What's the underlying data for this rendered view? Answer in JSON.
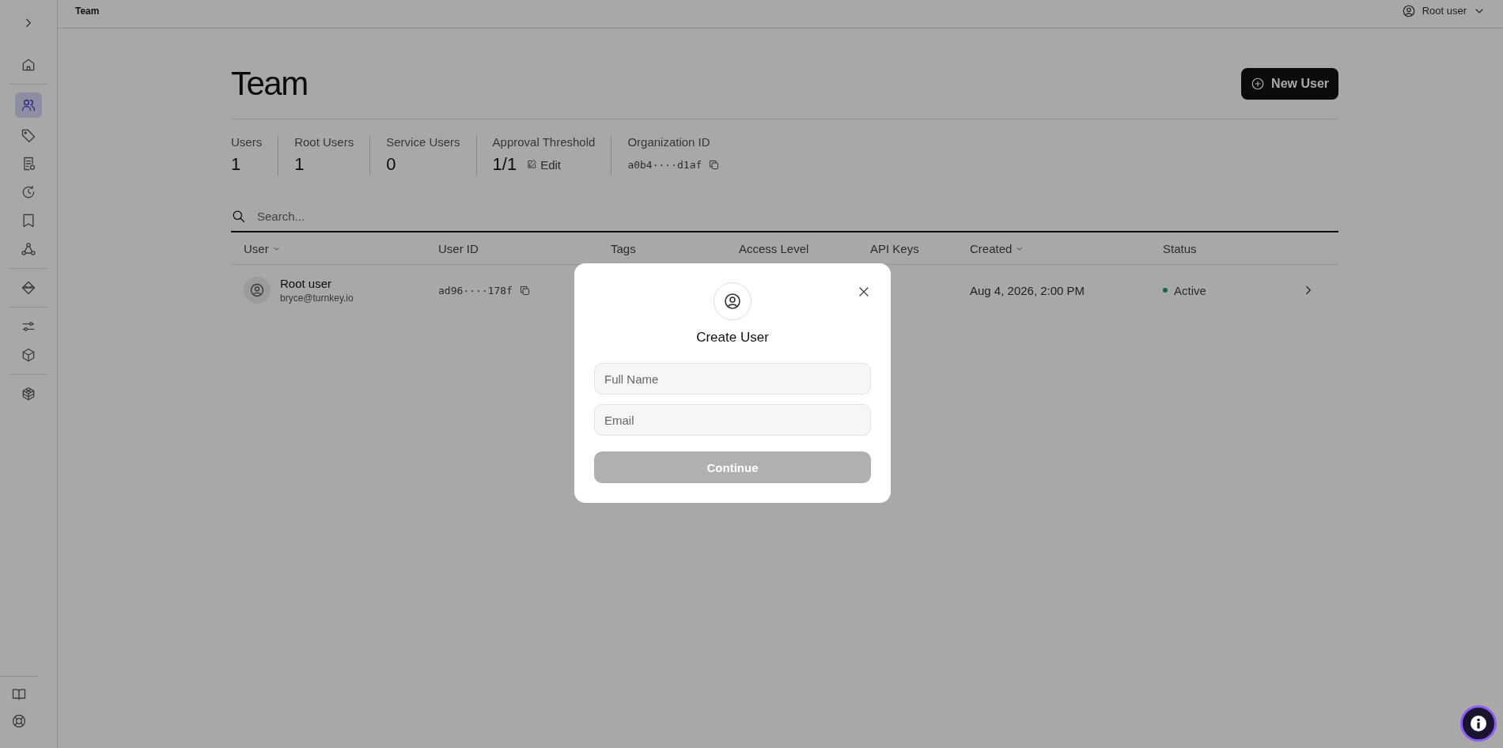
{
  "sidebar": {
    "groups": [
      {
        "items": [
          {
            "selected": false
          }
        ]
      },
      {
        "items": [
          {
            "selected": true
          },
          {
            "selected": false
          },
          {
            "selected": false
          },
          {
            "selected": false
          },
          {
            "selected": false
          },
          {
            "selected": false
          }
        ]
      },
      {
        "items": [
          {
            "selected": false
          }
        ]
      },
      {
        "items": [
          {
            "selected": false
          },
          {
            "selected": false
          }
        ]
      },
      {
        "items": [
          {
            "selected": false
          }
        ]
      }
    ],
    "bottom": [
      {
        "selected": false
      },
      {
        "selected": false
      }
    ]
  },
  "topbar": {
    "breadcrumb": "Team",
    "user": "Root user"
  },
  "page": {
    "title": "Team",
    "new_button": "New User",
    "stats": [
      {
        "label": "Users",
        "value": "1",
        "kind": "number"
      },
      {
        "label": "Root Users",
        "value": "1",
        "kind": "number"
      },
      {
        "label": "Service Users",
        "value": "0",
        "kind": "number"
      },
      {
        "label": "Approval Threshold",
        "value": "1/1",
        "kind": "editable",
        "action": "Edit"
      },
      {
        "label": "Organization ID",
        "value": "a0b4····d1af",
        "kind": "id"
      }
    ],
    "search": {
      "placeholder": "Search..."
    },
    "table": {
      "columns": [
        {
          "label": "User",
          "sorted": true
        },
        {
          "label": "User ID",
          "sorted": false
        },
        {
          "label": "Tags",
          "sorted": false
        },
        {
          "label": "Access Level",
          "sorted": false
        },
        {
          "label": "API Keys",
          "sorted": false
        },
        {
          "label": "Created",
          "sorted": true
        },
        {
          "label": "Status",
          "sorted": false
        }
      ],
      "rows": [
        {
          "name": "Root user",
          "email": "bryce@turnkey.io",
          "user_id": "ad96····178f",
          "created": "Aug 4, 2026, 2:00 PM",
          "status": "Active",
          "color": "#146847"
        }
      ]
    }
  },
  "modal": {
    "title": "Create User",
    "fields": [
      {
        "placeholder": "Full Name"
      },
      {
        "placeholder": "Email"
      }
    ],
    "button": {
      "label": "Continue",
      "disabled": true
    }
  }
}
